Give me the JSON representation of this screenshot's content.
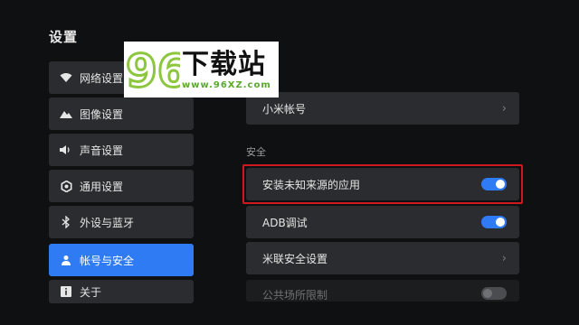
{
  "page": {
    "title": "设置"
  },
  "menu": {
    "items": [
      {
        "label": "网络设置",
        "icon": "wifi-icon"
      },
      {
        "label": "图像设置",
        "icon": "image-icon"
      },
      {
        "label": "声音设置",
        "icon": "speaker-icon"
      },
      {
        "label": "通用设置",
        "icon": "gear-icon"
      },
      {
        "label": "外设与蓝牙",
        "icon": "bluetooth-icon"
      },
      {
        "label": "帐号与安全",
        "icon": "user-icon",
        "active": true
      },
      {
        "label": "关于",
        "icon": "info-icon"
      }
    ]
  },
  "panel": {
    "account_row": {
      "label": "小米帐号"
    },
    "section_title": "安全",
    "unknown_sources": {
      "label": "安装未知来源的应用",
      "enabled": true
    },
    "adb": {
      "label": "ADB调试",
      "enabled": true
    },
    "mi_security": {
      "label": "米联安全设置"
    },
    "public_restrict": {
      "label": "公共场所限制",
      "enabled": false
    }
  },
  "watermark": {
    "big": "下载站",
    "url": "www.96XZ.com",
    "logo_text": "96"
  },
  "colors": {
    "accent": "#2f7bf3",
    "highlight": "#d0191f",
    "watermark_green": "#5aa92e"
  }
}
